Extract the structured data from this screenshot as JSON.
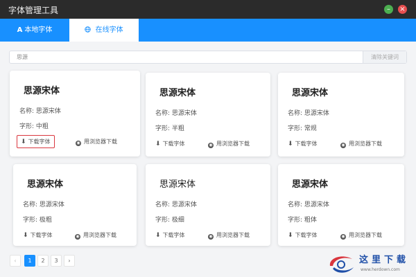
{
  "window": {
    "title": "字体管理工具"
  },
  "tabs": [
    {
      "label": "本地字体",
      "icon": "A"
    },
    {
      "label": "在线字体",
      "icon": "globe-icon"
    }
  ],
  "search": {
    "value": "思源",
    "clear_label": "清除关键词"
  },
  "cards": [
    {
      "font_name": "思源宋体",
      "name_label": "名称: 思源宋体",
      "weight_label": "字形: 中粗",
      "download_label": "下载字体",
      "browser_label": "用浏览器下载"
    },
    {
      "font_name": "思源宋体",
      "name_label": "名称: 思源宋体",
      "weight_label": "字形: 半粗",
      "download_label": "下载字体",
      "browser_label": "用浏览器下载"
    },
    {
      "font_name": "思源宋体",
      "name_label": "名称: 思源宋体",
      "weight_label": "字形: 常规",
      "download_label": "下载字体",
      "browser_label": "用浏览器下载"
    },
    {
      "font_name": "思源宋体",
      "name_label": "名称: 思源宋体",
      "weight_label": "字形: 极粗",
      "download_label": "下载字体",
      "browser_label": "用浏览器下载"
    },
    {
      "font_name": "思源宋体",
      "name_label": "名称: 思源宋体",
      "weight_label": "字形: 极细",
      "download_label": "下载字体",
      "browser_label": "用浏览器下载"
    },
    {
      "font_name": "思源宋体",
      "name_label": "名称: 思源宋体",
      "weight_label": "字形: 粗体",
      "download_label": "下载字体",
      "browser_label": "用浏览器下载"
    }
  ],
  "pagination": {
    "prev": "‹",
    "pages": [
      "1",
      "2",
      "3"
    ],
    "next": "›",
    "current": "1"
  },
  "watermark": {
    "text": "这里下载",
    "url": "www.herdown.com"
  },
  "colors": {
    "accent": "#1890ff",
    "highlight": "#d9363e",
    "titlebar": "#2b2b2b"
  }
}
